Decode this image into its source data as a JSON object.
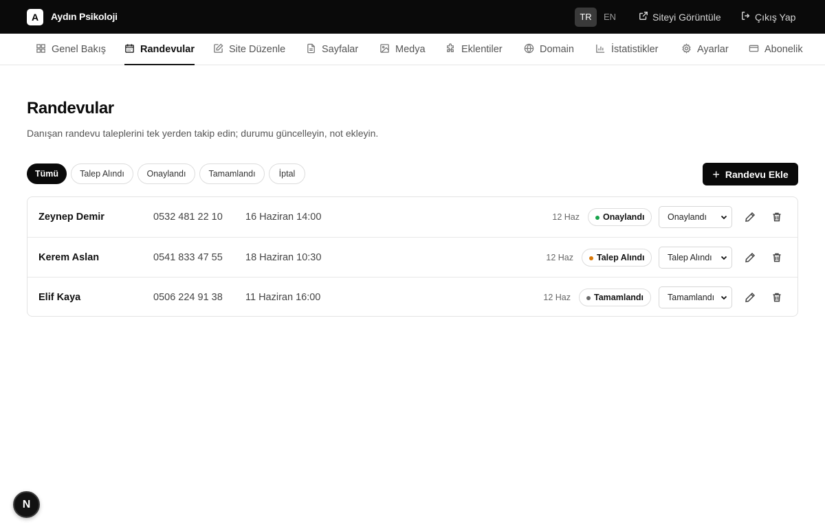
{
  "topbar": {
    "logo_letter": "A",
    "brand": "Aydın Psikoloji",
    "lang_tr": "TR",
    "lang_en": "EN",
    "view_site": "Siteyi Görüntüle",
    "logout": "Çıkış Yap"
  },
  "nav": {
    "items": [
      {
        "label": "Genel Bakış",
        "icon": "grid-icon"
      },
      {
        "label": "Randevular",
        "icon": "calendar-icon",
        "active": true
      },
      {
        "label": "Site Düzenle",
        "icon": "edit-icon"
      },
      {
        "label": "Sayfalar",
        "icon": "file-icon"
      },
      {
        "label": "Medya",
        "icon": "image-icon"
      },
      {
        "label": "Eklentiler",
        "icon": "puzzle-icon"
      },
      {
        "label": "Domain",
        "icon": "globe-icon"
      },
      {
        "label": "İstatistikler",
        "icon": "bar-chart-icon"
      },
      {
        "label": "Ayarlar",
        "icon": "gear-icon"
      },
      {
        "label": "Abonelik",
        "icon": "credit-card-icon"
      }
    ]
  },
  "header": {
    "title": "Randevular",
    "subtitle": "Danışan randevu taleplerini tek yerden takip edin; durumu güncelleyin, not ekleyin."
  },
  "filters": {
    "chips": [
      "Tümü",
      "Talep Alındı",
      "Onaylandı",
      "Tamamlandı",
      "İptal"
    ],
    "active": "Tümü"
  },
  "add_button": {
    "label": "Randevu Ekle"
  },
  "status_colors": {
    "Onaylandı": "#16a34a",
    "Talep Alındı": "#d97706",
    "Tamamlandı": "#6b6b6b"
  },
  "appointments": [
    {
      "name": "Zeynep Demir",
      "phone": "0532 481 22 10",
      "date": "16 Haziran 14:00",
      "created": "12 Haz",
      "status": "Onaylandı",
      "select_value": "Onaylandı"
    },
    {
      "name": "Kerem Aslan",
      "phone": "0541 833 47 55",
      "date": "18 Haziran 10:30",
      "created": "12 Haz",
      "status": "Talep Alındı",
      "select_value": "Talep Alındı"
    },
    {
      "name": "Elif Kaya",
      "phone": "0506 224 91 38",
      "date": "11 Haziran 16:00",
      "created": "12 Haz",
      "status": "Tamamlandı",
      "select_value": "Tamamlandı"
    }
  ],
  "floating": {
    "label": "N"
  }
}
